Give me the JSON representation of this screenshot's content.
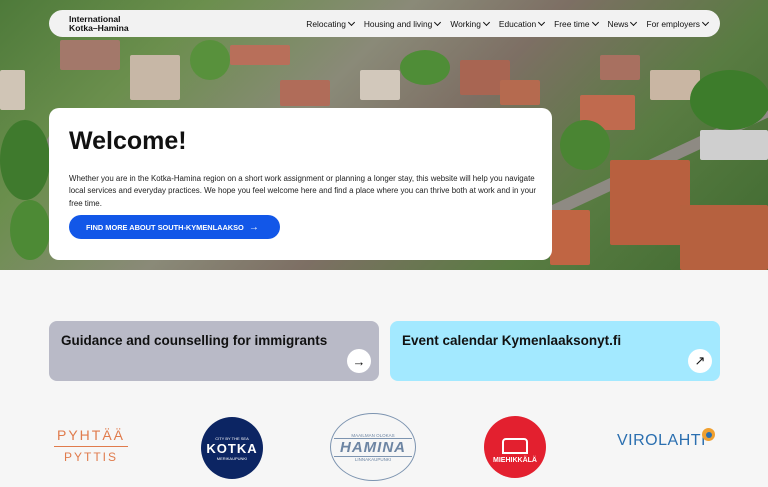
{
  "header": {
    "logo_line1": "International",
    "logo_line2": "Kotka–Hamina",
    "nav": [
      {
        "label": "Relocating"
      },
      {
        "label": "Housing and living"
      },
      {
        "label": "Working"
      },
      {
        "label": "Education"
      },
      {
        "label": "Free time"
      },
      {
        "label": "News"
      },
      {
        "label": "For employers"
      }
    ]
  },
  "welcome": {
    "title": "Welcome!",
    "body": "Whether you are in the Kotka-Hamina region on a short work assignment or planning a longer stay, this website will help you navigate local services and everyday practices. We hope you feel welcome here and find a place where you can thrive both at work and in your free time.",
    "cta_label": "FIND MORE ABOUT SOUTH-KYMENLAAKSO",
    "cta_icon": "arrow-right-icon"
  },
  "cards": [
    {
      "title": "Guidance and counselling for immigrants",
      "icon": "arrow-right-icon",
      "color": "#b9bac7"
    },
    {
      "title": "Event calendar Kymenlaaksonyt.fi",
      "icon": "external-arrow-icon",
      "color": "#a3e9ff"
    }
  ],
  "municipalities": {
    "pyhtaa": {
      "line1": "PYHTÄÄ",
      "line2": "PYTTIS"
    },
    "kotka": {
      "top": "CITY BY THE SEA",
      "name": "KOTKA",
      "bottom": "MERIKAUPUNKI"
    },
    "hamina": {
      "top": "MAAILMAN OLOKAS",
      "name": "HAMINA",
      "bottom": "LINNAKAUPUNKI"
    },
    "miehikkala": {
      "name": "MIEHIKKÄLÄ"
    },
    "virolahti": {
      "name": "VIROLAHTI"
    }
  },
  "colors": {
    "primary": "#1257e8",
    "card_grey": "#b9bac7",
    "card_blue": "#a3e9ff"
  }
}
